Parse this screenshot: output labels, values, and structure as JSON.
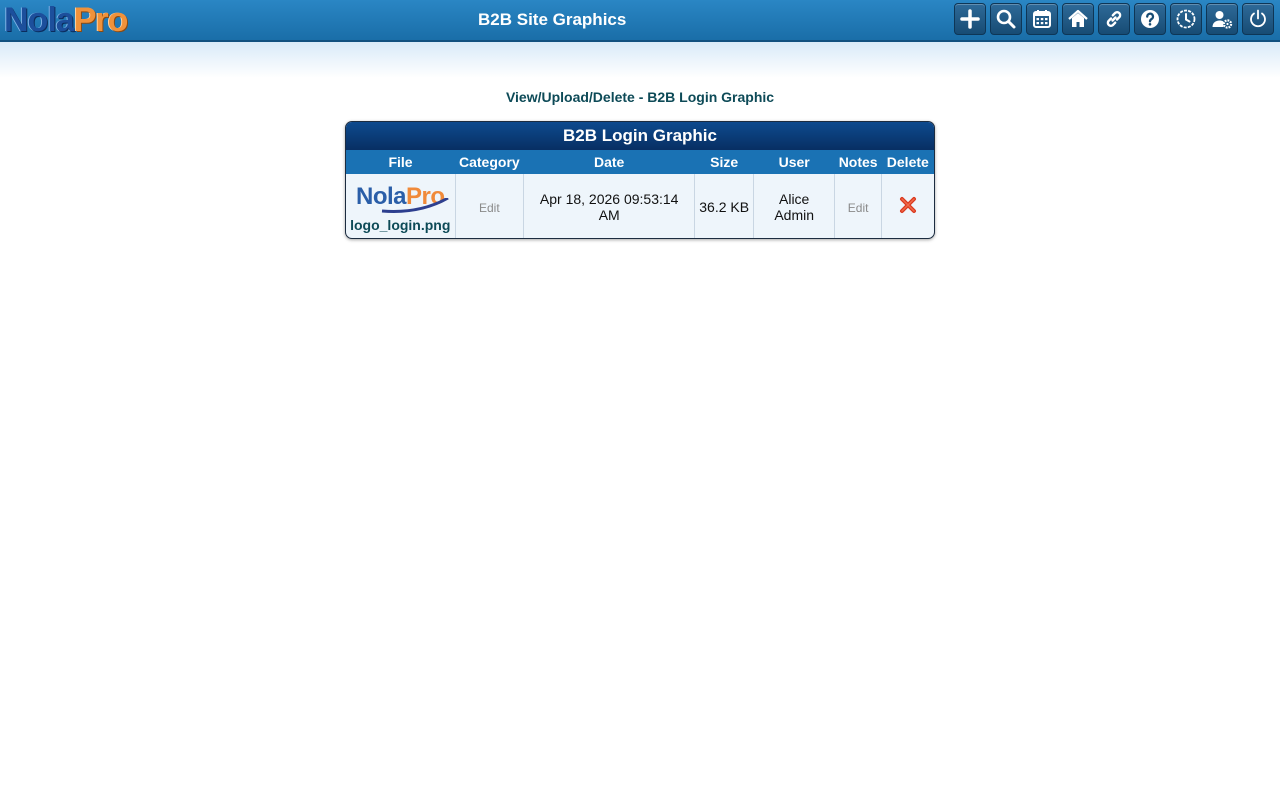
{
  "app": {
    "logo_part1": "Nola",
    "logo_part2": "Pro",
    "page_title": "B2B Site Graphics"
  },
  "toolbar": {
    "buttons": [
      {
        "name": "add",
        "icon": "plus-icon"
      },
      {
        "name": "search",
        "icon": "search-icon"
      },
      {
        "name": "calendar",
        "icon": "calendar-icon"
      },
      {
        "name": "home",
        "icon": "home-icon"
      },
      {
        "name": "links",
        "icon": "link-icon"
      },
      {
        "name": "help",
        "icon": "help-icon"
      },
      {
        "name": "history",
        "icon": "clock-icon"
      },
      {
        "name": "user-settings",
        "icon": "user-gear-icon"
      },
      {
        "name": "logout",
        "icon": "power-icon"
      }
    ]
  },
  "main": {
    "subtitle": "View/Upload/Delete - B2B Login Graphic",
    "panel_title": "B2B Login Graphic",
    "columns": [
      "File",
      "Category",
      "Date",
      "Size",
      "User",
      "Notes",
      "Delete"
    ],
    "rows": [
      {
        "thumb_part1": "Nola",
        "thumb_part2": "Pro",
        "file": "logo_login.png",
        "category": "Edit",
        "date": "Apr 18, 2026 09:53:14 AM",
        "size": "36.2 KB",
        "user": "Alice Admin",
        "notes": "Edit",
        "delete_icon": "x-icon"
      }
    ]
  },
  "colors": {
    "topbar": "#1a6ea8",
    "panel_header": "#082f63",
    "table_header": "#1a72b4",
    "accent_text": "#0d4a57",
    "delete": "#d9381e"
  }
}
